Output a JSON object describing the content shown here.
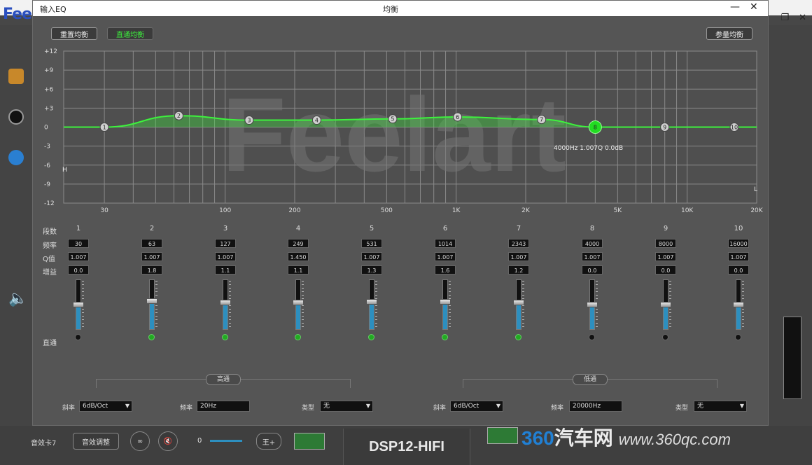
{
  "app": {
    "logo": "Fee",
    "bottom_label": "音效卡7",
    "bottom_button": "音效调整",
    "model": "DSP12-HIFI",
    "slider_value": "0",
    "power_label": "王+"
  },
  "watermark": {
    "number": "360",
    "text": "汽车网",
    "url": "www.360qc.com"
  },
  "dialog": {
    "title_left": "输入EQ",
    "title_center": "均衡",
    "minimize": "—",
    "close": "✕",
    "buttons": {
      "reset": "重置均衡",
      "direct": "直通均衡",
      "param": "参量均衡"
    },
    "graph": {
      "y_ticks": [
        "+12",
        "+9",
        "+6",
        "+3",
        "0",
        "-3",
        "-6",
        "-9",
        "-12"
      ],
      "x_ticks": [
        "30",
        "100",
        "200",
        "500",
        "1K",
        "2K",
        "5K",
        "10K",
        "20K"
      ],
      "readout": "4000Hz 1.007Q 0.0dB",
      "marker_low": "H",
      "marker_high": "L",
      "brand": "Feelart"
    },
    "row_labels": {
      "band": "段数",
      "freq": "频率",
      "q": "Q值",
      "gain": "增益",
      "direct": "直通"
    },
    "bands": [
      {
        "num": "1",
        "freq": "30",
        "q": "1.007",
        "gain": "0.0",
        "level": 0.5,
        "on": false
      },
      {
        "num": "2",
        "freq": "63",
        "q": "1.007",
        "gain": "1.8",
        "level": 0.58,
        "on": true
      },
      {
        "num": "3",
        "freq": "127",
        "q": "1.007",
        "gain": "1.1",
        "level": 0.55,
        "on": true
      },
      {
        "num": "4",
        "freq": "249",
        "q": "1.450",
        "gain": "1.1",
        "level": 0.55,
        "on": true
      },
      {
        "num": "5",
        "freq": "531",
        "q": "1.007",
        "gain": "1.3",
        "level": 0.56,
        "on": true
      },
      {
        "num": "6",
        "freq": "1014",
        "q": "1.007",
        "gain": "1.6",
        "level": 0.57,
        "on": true
      },
      {
        "num": "7",
        "freq": "2343",
        "q": "1.007",
        "gain": "1.2",
        "level": 0.55,
        "on": true
      },
      {
        "num": "8",
        "freq": "4000",
        "q": "1.007",
        "gain": "0.0",
        "level": 0.5,
        "on": false
      },
      {
        "num": "9",
        "freq": "8000",
        "q": "1.007",
        "gain": "0.0",
        "level": 0.5,
        "on": false
      },
      {
        "num": "10",
        "freq": "16000",
        "q": "1.007",
        "gain": "0.0",
        "level": 0.5,
        "on": false
      }
    ],
    "highpass": {
      "label": "高通",
      "slope_label": "斜率",
      "slope": "6dB/Oct",
      "freq_label": "频率",
      "freq": "20Hz",
      "type_label": "类型",
      "type": "无"
    },
    "lowpass": {
      "label": "低通",
      "slope_label": "斜率",
      "slope": "6dB/Oct",
      "freq_label": "频率",
      "freq": "20000Hz",
      "type_label": "类型",
      "type": "无"
    }
  },
  "colors": {
    "curve": "#3df23d",
    "selected": "#22dd22",
    "slider": "#2d8fbf"
  }
}
